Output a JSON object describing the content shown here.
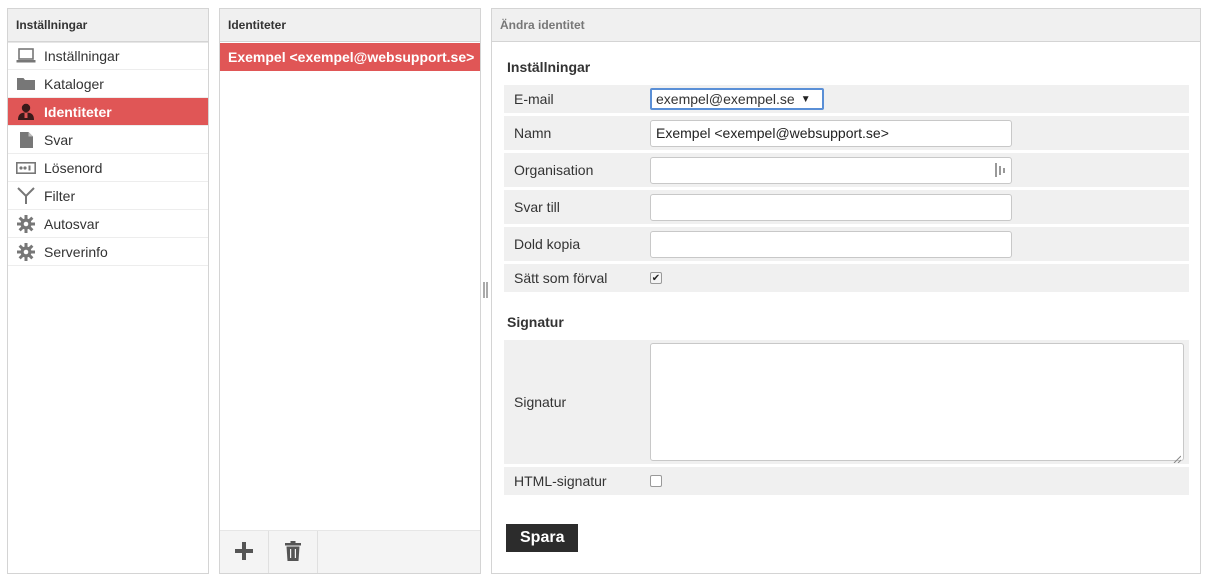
{
  "settings": {
    "header": "Inställningar",
    "items": [
      {
        "label": "Inställningar",
        "icon": "laptop-icon"
      },
      {
        "label": "Kataloger",
        "icon": "folder-icon"
      },
      {
        "label": "Identiteter",
        "icon": "user-icon",
        "selected": true
      },
      {
        "label": "Svar",
        "icon": "document-icon"
      },
      {
        "label": "Lösenord",
        "icon": "password-icon"
      },
      {
        "label": "Filter",
        "icon": "filter-icon"
      },
      {
        "label": "Autosvar",
        "icon": "gear-icon"
      },
      {
        "label": "Serverinfo",
        "icon": "gear-icon"
      }
    ]
  },
  "identities": {
    "header": "Identiteter",
    "items": [
      {
        "label": "Exempel <exempel@websupport.se>"
      }
    ]
  },
  "edit": {
    "header": "Ändra identitet",
    "section_settings": "Inställningar",
    "email_label": "E-mail",
    "email_value": "exempel@exempel.se",
    "name_label": "Namn",
    "name_value": "Exempel <exempel@websupport.se>",
    "org_label": "Organisation",
    "org_value": "",
    "reply_label": "Svar till",
    "reply_value": "",
    "bcc_label": "Dold kopia",
    "bcc_value": "",
    "default_label": "Sätt som förval",
    "default_checked": true,
    "section_signature": "Signatur",
    "signature_label": "Signatur",
    "signature_value": "",
    "html_sig_label": "HTML-signatur",
    "html_sig_checked": false,
    "save_label": "Spara"
  },
  "colors": {
    "selected": "#e05656",
    "save_button": "#2c2c2c"
  }
}
